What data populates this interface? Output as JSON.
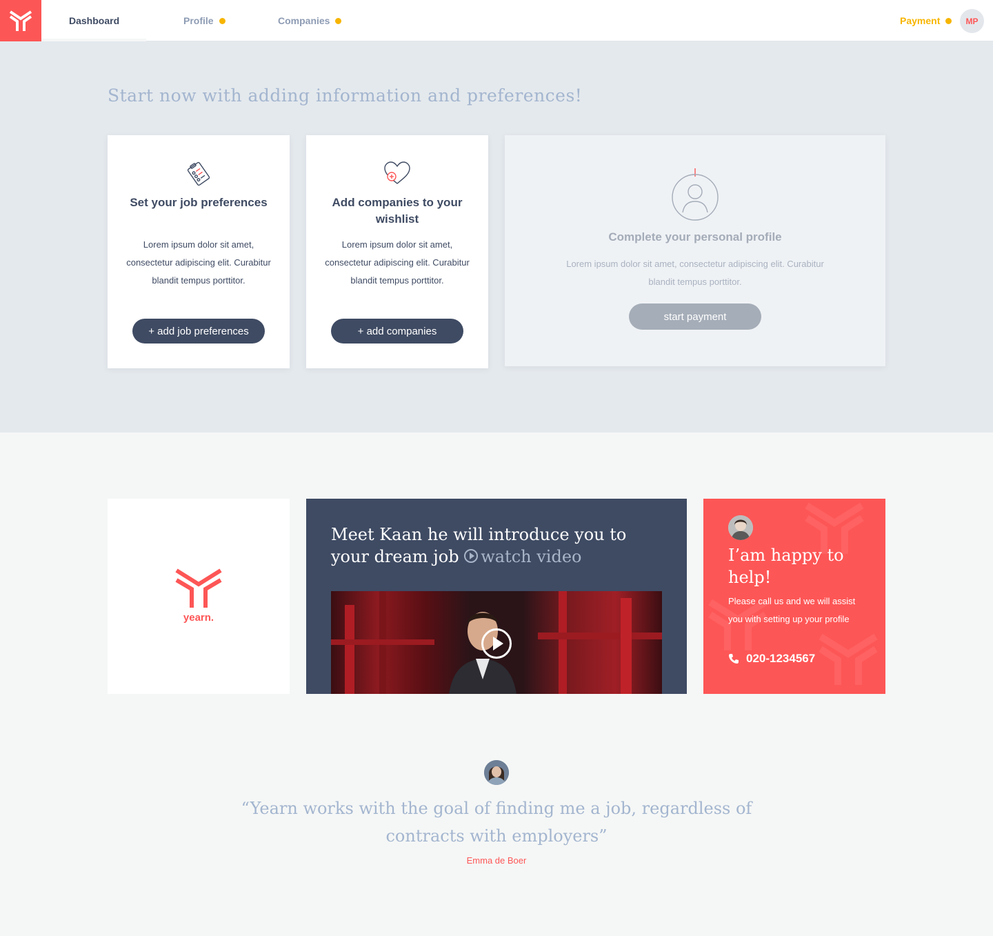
{
  "nav": {
    "tabs": [
      {
        "label": "Dashboard",
        "active": true,
        "indicator": false
      },
      {
        "label": "Profile",
        "active": false,
        "indicator": true
      },
      {
        "label": "Companies",
        "active": false,
        "indicator": true
      }
    ],
    "payment_label": "Payment",
    "user_initials": "MP"
  },
  "colors": {
    "brand": "#fd5656",
    "dark": "#3f4b63",
    "warning": "#f7b500",
    "muted": "#a3b5cf"
  },
  "onboarding": {
    "headline": "Start now with adding information and preferences!",
    "cards": [
      {
        "icon": "checklist-icon",
        "title": "Set your job preferences",
        "text": "Lorem ipsum dolor sit amet, consectetur adipiscing elit. Curabitur blandit tempus porttitor.",
        "button": "+ add job preferences"
      },
      {
        "icon": "heart-plus-icon",
        "title": "Add companies to your wishlist",
        "text": "Lorem ipsum dolor sit amet, consectetur adipiscing elit. Curabitur blandit tempus porttitor.",
        "button": "+ add companies"
      }
    ],
    "profile_card": {
      "icon": "user-circle-icon",
      "title": "Complete your personal profile",
      "text": "Lorem ipsum dolor sit amet, consectetur adipiscing elit. Curabitur blandit tempus porttitor.",
      "button": "start payment"
    }
  },
  "brand": {
    "name": "yearn."
  },
  "video": {
    "title": "Meet Kaan he will introduce you to your dream job",
    "watch_label": "watch video"
  },
  "help": {
    "title": "I’am happy to help!",
    "text": "Please call us and we will assist you with setting up your profile",
    "phone": "020-1234567"
  },
  "testimonial": {
    "quote": "“Yearn works with the goal of finding me a job, regardless of contracts with employers”",
    "author": "Emma de Boer"
  }
}
